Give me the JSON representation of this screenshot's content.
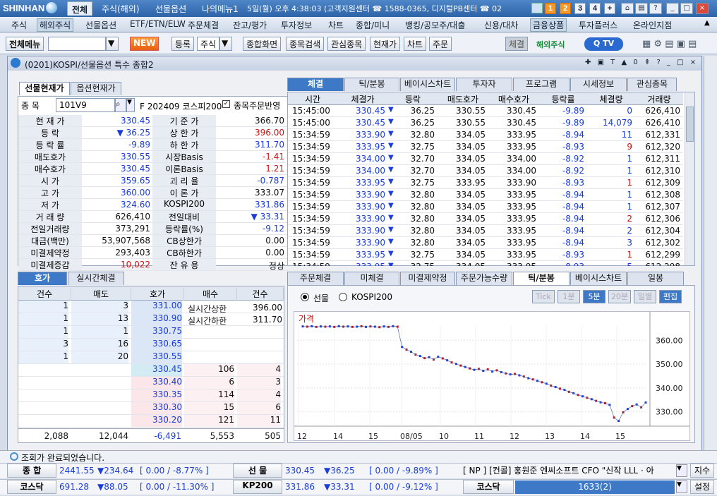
{
  "titlebar": {
    "logo": "SHINHAN",
    "tabs": [
      "전체",
      "주식(해외)",
      "선물옵션",
      "나의메뉴1"
    ],
    "info": "5일(월) 오후 4:38:03 (고객지원센터 ☎ 1588-0365, 디지털PB센터 ☎ 02",
    "nums": [
      "1",
      "2",
      "3",
      "4",
      "+"
    ]
  },
  "menu": [
    "주식",
    "해외주식",
    "선물옵션",
    "ETF/ETN/ELW",
    "주문체결",
    "잔고/평가",
    "투자정보",
    "차트",
    "종합/미니",
    "뱅킹/공모주/대출",
    "신용/대차",
    "금융상품",
    "투자플러스",
    "온라인지점"
  ],
  "toolbar": {
    "all_menu": "전체메뉴",
    "new": "NEW",
    "register": "등록",
    "stock": "주식",
    "integrated": "종합화면",
    "search": "종목검색",
    "watch": "관심종목",
    "current": "현재가",
    "chart": "차트",
    "order": "주문",
    "fill": "체결",
    "overseas": "해외주식"
  },
  "window": {
    "title": "(0201)KOSPI/선물옵션 특수 종합2"
  },
  "left": {
    "tabs": [
      "선물현재가",
      "옵션현재가"
    ],
    "code_label": "종  목",
    "code": "101V9",
    "code_desc": "F 202409 코스피200",
    "checkbox_label": "종목주문반영",
    "rows": [
      [
        "현 재 가",
        "330.45",
        "blue",
        "기 준 가",
        "366.70",
        "blk"
      ],
      [
        "등   락",
        "▼ 36.25",
        "blue",
        "상 한 가",
        "396.00",
        "red"
      ],
      [
        "등 락 률",
        "-9.89",
        "blue",
        "하 한 가",
        "311.70",
        "blue"
      ],
      [
        "매도호가",
        "330.55",
        "blue",
        "시장Basis",
        "-1.41",
        "red"
      ],
      [
        "매수호가",
        "330.45",
        "blue",
        "이론Basis",
        "1.21",
        "red"
      ],
      [
        "시   가",
        "359.65",
        "blue",
        "괴 리 율",
        "-0.787",
        "blue"
      ],
      [
        "고   가",
        "360.00",
        "blue",
        "이 론 가",
        "333.07",
        "blk"
      ],
      [
        "저   가",
        "324.60",
        "blue",
        "KOSPI200",
        "331.86",
        "blue"
      ],
      [
        "거 래 량",
        "626,410",
        "blk",
        "전일대비",
        "▼ 33.31",
        "blue"
      ],
      [
        "전일거래량",
        "373,291",
        "blk",
        "등락률(%)",
        "-9.12",
        "blue"
      ],
      [
        "대금(백만)",
        "53,907,568",
        "blk",
        "CB상한가",
        "0.00",
        "blk"
      ],
      [
        "미결제약정",
        "293,403",
        "blk",
        "CB하한가",
        "0.00",
        "blk"
      ],
      [
        "미결제증감",
        "10,022",
        "red",
        "잔 유 용",
        "정상",
        "blk"
      ]
    ]
  },
  "right": {
    "tabs": [
      "체결",
      "틱/분봉",
      "베이시스차트",
      "투자자",
      "프로그램",
      "시세정보",
      "관심종목"
    ],
    "headers": [
      "시간",
      "체결가",
      "등락",
      "매도호가",
      "매수호가",
      "등락률",
      "체결량",
      "거래량"
    ],
    "rows": [
      [
        "15:45:00",
        "330.45",
        "36.25",
        "330.55",
        "330.45",
        "-9.89",
        "0",
        "626,410"
      ],
      [
        "15:45:00",
        "330.45",
        "36.25",
        "330.55",
        "330.45",
        "-9.89",
        "14,079",
        "626,410"
      ],
      [
        "15:34:59",
        "333.90",
        "32.80",
        "334.05",
        "333.95",
        "-8.94",
        "11",
        "612,331"
      ],
      [
        "15:34:59",
        "333.95",
        "32.75",
        "334.05",
        "333.95",
        "-8.93",
        "9",
        "612,320"
      ],
      [
        "15:34:59",
        "334.00",
        "32.70",
        "334.05",
        "334.00",
        "-8.92",
        "1",
        "612,311"
      ],
      [
        "15:34:59",
        "334.00",
        "32.70",
        "334.05",
        "334.00",
        "-8.92",
        "1",
        "612,310"
      ],
      [
        "15:34:59",
        "333.95",
        "32.75",
        "333.95",
        "333.90",
        "-8.93",
        "1",
        "612,309"
      ],
      [
        "15:34:59",
        "333.90",
        "32.80",
        "334.05",
        "333.95",
        "-8.94",
        "1",
        "612,308"
      ],
      [
        "15:34:59",
        "333.90",
        "32.80",
        "334.05",
        "333.95",
        "-8.94",
        "1",
        "612,307"
      ],
      [
        "15:34:59",
        "333.90",
        "32.80",
        "334.05",
        "333.95",
        "-8.94",
        "2",
        "612,306"
      ],
      [
        "15:34:59",
        "333.90",
        "32.80",
        "334.05",
        "333.95",
        "-8.94",
        "2",
        "612,304"
      ],
      [
        "15:34:59",
        "333.90",
        "32.80",
        "334.05",
        "333.95",
        "-8.94",
        "3",
        "612,302"
      ],
      [
        "15:34:59",
        "333.95",
        "32.75",
        "334.05",
        "333.95",
        "-8.93",
        "1",
        "612,299"
      ],
      [
        "15:34:59",
        "333.95",
        "32.75",
        "334.05",
        "333.95",
        "-8.93",
        "5",
        "612,298"
      ]
    ]
  },
  "orderbook": {
    "tabs": [
      "호가",
      "실시간체결"
    ],
    "headers": [
      "건수",
      "매도",
      "호가",
      "매수",
      "건수"
    ],
    "asks": [
      [
        "1",
        "3",
        "331.00"
      ],
      [
        "1",
        "13",
        "330.90"
      ],
      [
        "1",
        "1",
        "330.75"
      ],
      [
        "3",
        "16",
        "330.65"
      ],
      [
        "1",
        "20",
        "330.55"
      ]
    ],
    "bids": [
      [
        "330.45",
        "106",
        "4"
      ],
      [
        "330.40",
        "6",
        "3"
      ],
      [
        "330.35",
        "114",
        "4"
      ],
      [
        "330.30",
        "15",
        "6"
      ],
      [
        "330.20",
        "121",
        "11"
      ]
    ],
    "limit_up_label": "실시간상한",
    "limit_up": "396.00",
    "limit_dn_label": "실시간하한",
    "limit_dn": "311.70",
    "totals": [
      "2,088",
      "12,044",
      "-6,491",
      "5,553",
      "505"
    ]
  },
  "chartpanel": {
    "tabs": [
      "주문체결",
      "미체결",
      "미결제약정",
      "주문가능수량",
      "틱/분봉",
      "베이시스차트",
      "일봉"
    ],
    "radio1": "선물",
    "radio2": "KOSPI200",
    "btns": [
      "Tick",
      "1분",
      "5분",
      "20분",
      "일별",
      "편집"
    ],
    "legend": "가격"
  },
  "chart_data": {
    "type": "line",
    "ylabel": "가격",
    "yticks": [
      "360.00",
      "350.00",
      "340.00",
      "330.00"
    ],
    "ylim": [
      324,
      366
    ],
    "xticks": [
      "12",
      "14",
      "15",
      "08/05",
      "10",
      "11",
      "12",
      "13",
      "14",
      "15"
    ],
    "values": [
      365.8,
      365.7,
      365.9,
      365.6,
      365.8,
      365.7,
      365.8,
      365.6,
      365.9,
      365.7,
      365.8,
      365.6,
      365.7,
      365.9,
      365.6,
      365.8,
      365.7,
      365.5,
      365.8,
      365.6,
      365.9,
      365.7,
      357.2,
      356.1,
      355.2,
      354.0,
      353.4,
      352.5,
      352.9,
      351.9,
      353.1,
      352.4,
      351.6,
      350.7,
      350.1,
      349.4,
      348.8,
      348.2,
      347.6,
      348.0,
      347.2,
      347.8,
      346.9,
      347.4,
      346.6,
      346.1,
      345.7,
      345.9,
      345.3,
      344.8,
      344.1,
      343.6,
      343.0,
      342.4,
      341.8,
      341.0,
      340.4,
      339.7,
      339.2,
      338.4,
      337.8,
      337.1,
      336.5,
      335.9,
      335.3,
      334.6,
      334.0,
      333.6,
      332.9,
      327.6,
      326.2,
      329.8,
      331.2,
      332.4,
      333.1,
      331.9,
      333.9
    ]
  },
  "status": {
    "msg": "조회가 완료되었습니다."
  },
  "ticker1": {
    "a_label": "종  합",
    "a_val": "2441.55",
    "a_chg": "▼234.64",
    "a_pct": "[ 0.00  / -8.77% ]",
    "b_label": "선  물",
    "b_val": "330.45",
    "b_chg": "▼36.25",
    "b_pct": "[ 0.00  / -9.89% ]",
    "news": "[ NP ] [컨콜] 홍원준 엔씨소프트 CFO \"신작 LLL · 아",
    "btn": "지수"
  },
  "ticker2": {
    "a_label": "코스닥",
    "a_val": "691.28",
    "a_chg": "▼88.05",
    "a_pct": "[ 0.00  / -11.30% ]",
    "b_label": "KP200",
    "b_val": "331.86",
    "b_chg": "▼33.31",
    "b_pct": "[ 0.00  / -9.12% ]",
    "c_label": "코스닥",
    "c_val": "1633(2)",
    "btn": "설정"
  },
  "colors": {
    "up": "#d01010",
    "down": "#1a3cd8",
    "accent": "#f59a2a"
  }
}
